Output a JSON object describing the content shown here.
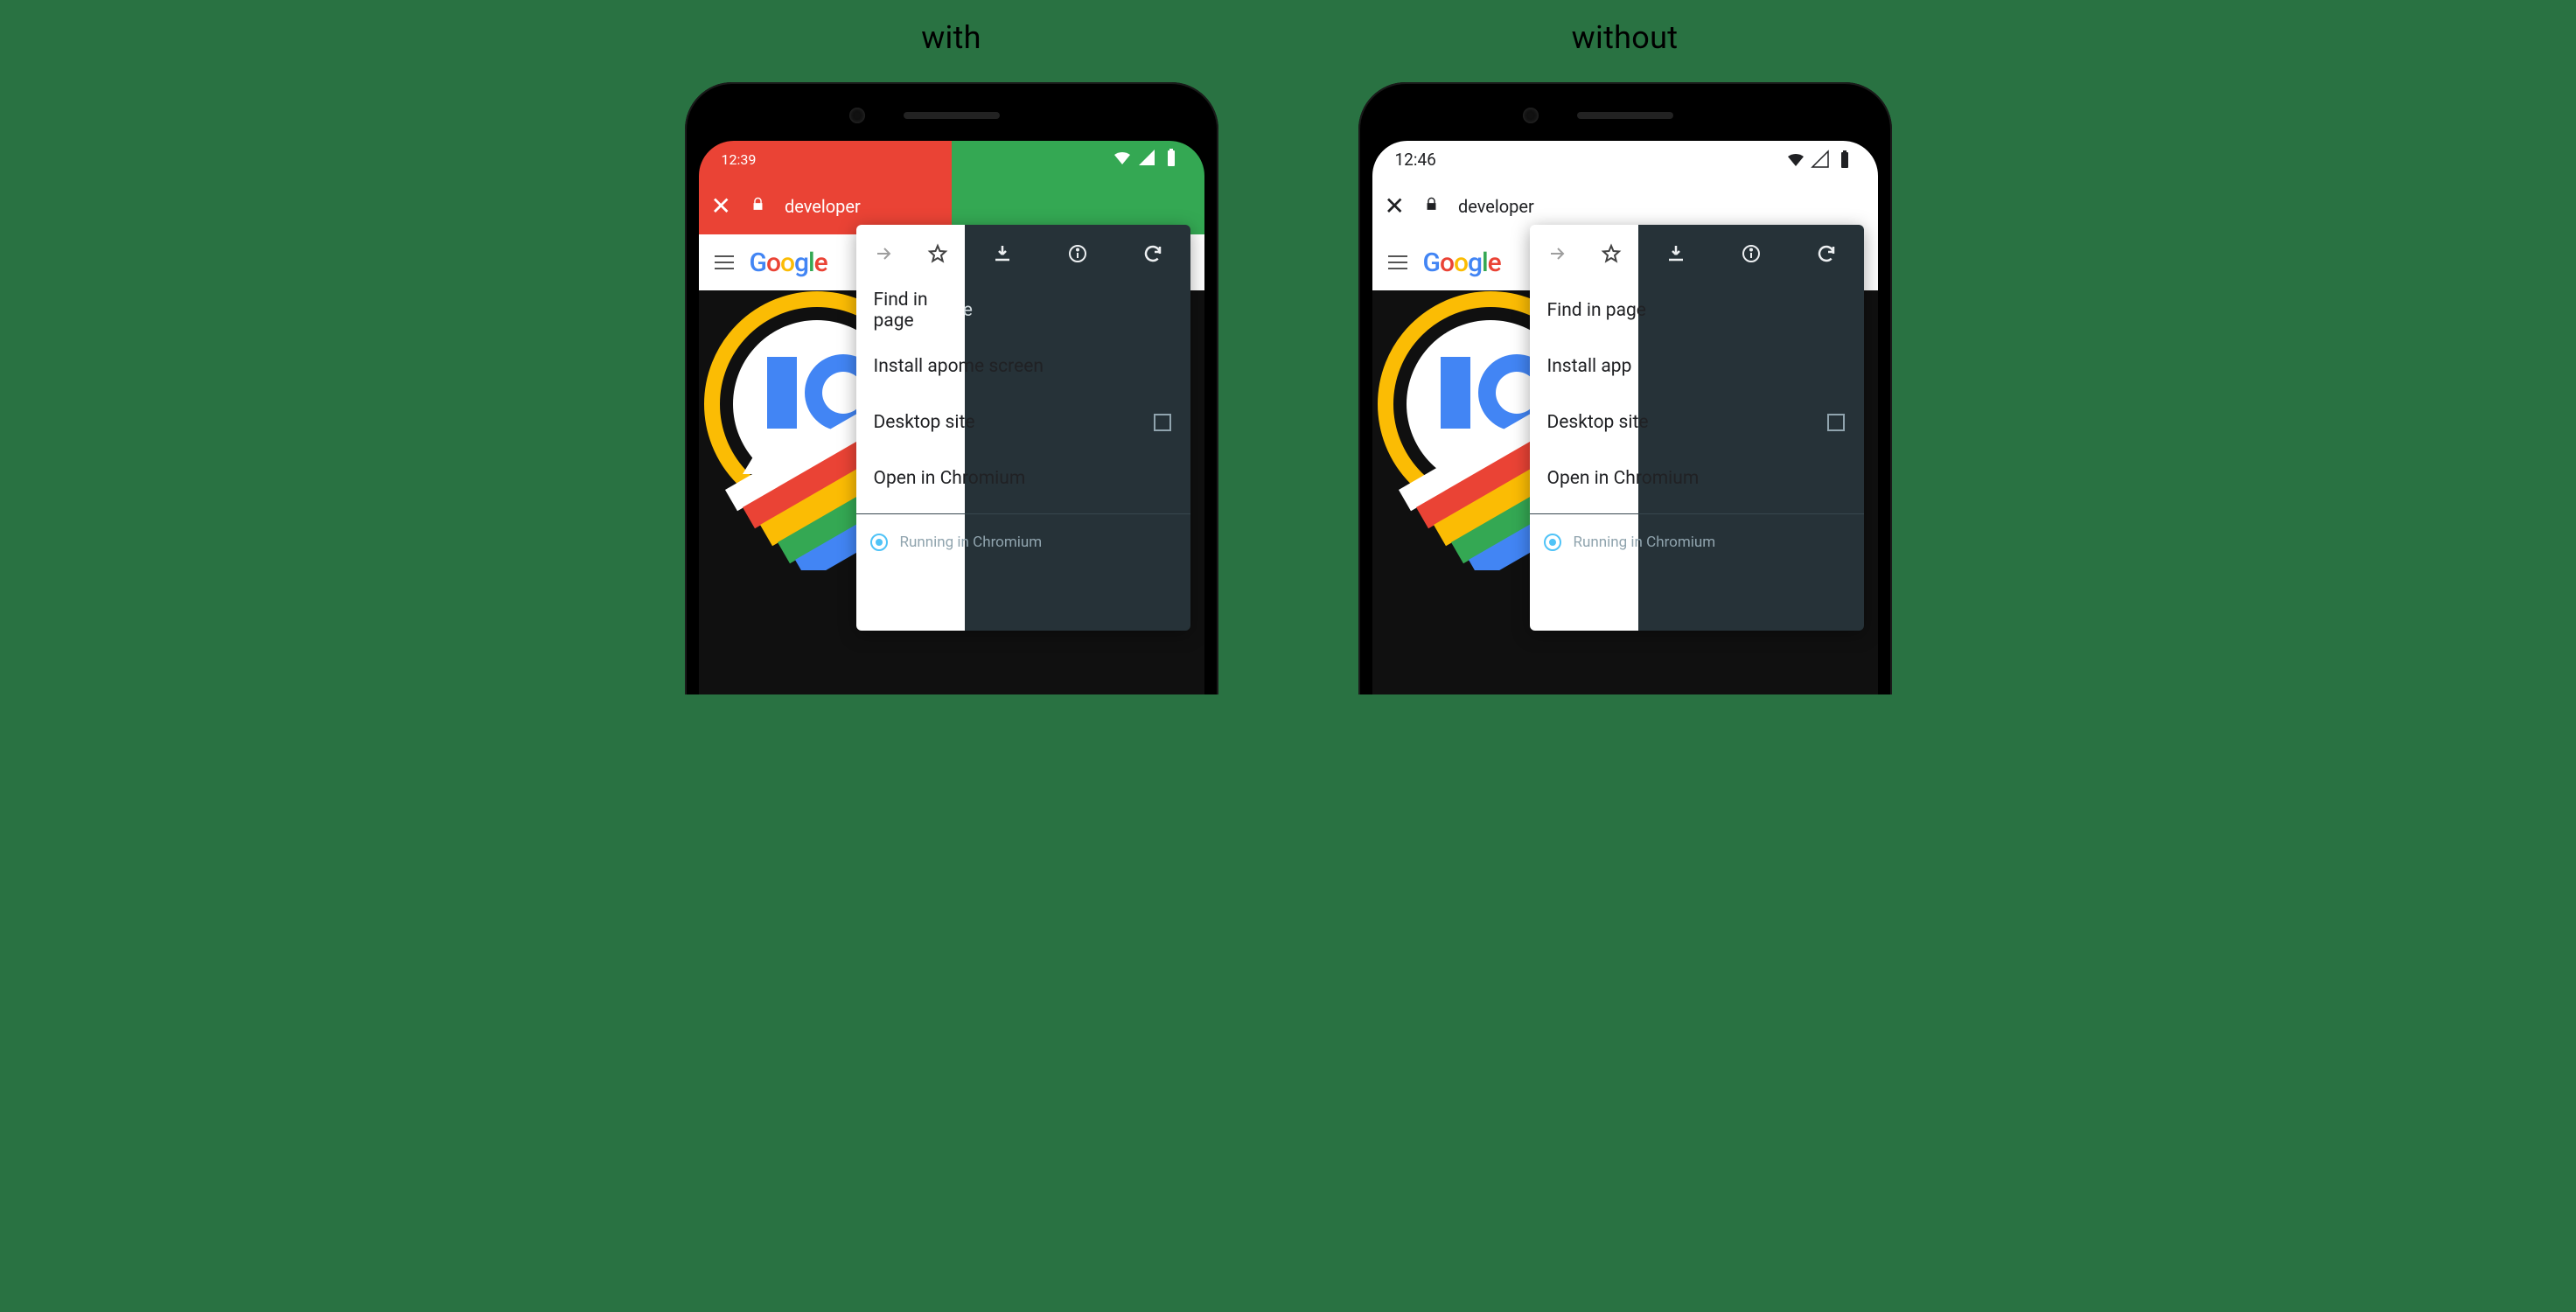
{
  "labels": {
    "with": "with",
    "without": "without"
  },
  "left": {
    "time": "12:39",
    "url": "developer",
    "google_text": "Google",
    "menu": {
      "find": "Find in page",
      "install": "Install apome screen",
      "desktop": "Desktop site",
      "open": "Open in Chromium",
      "footer": "Running in Chromium"
    }
  },
  "right": {
    "time": "12:46",
    "url": "developer",
    "google_text": "Google",
    "menu": {
      "find": "Find in page",
      "install": "Install app",
      "desktop": "Desktop site",
      "open": "Open in Chromium",
      "footer": "Running in Chromium"
    }
  }
}
